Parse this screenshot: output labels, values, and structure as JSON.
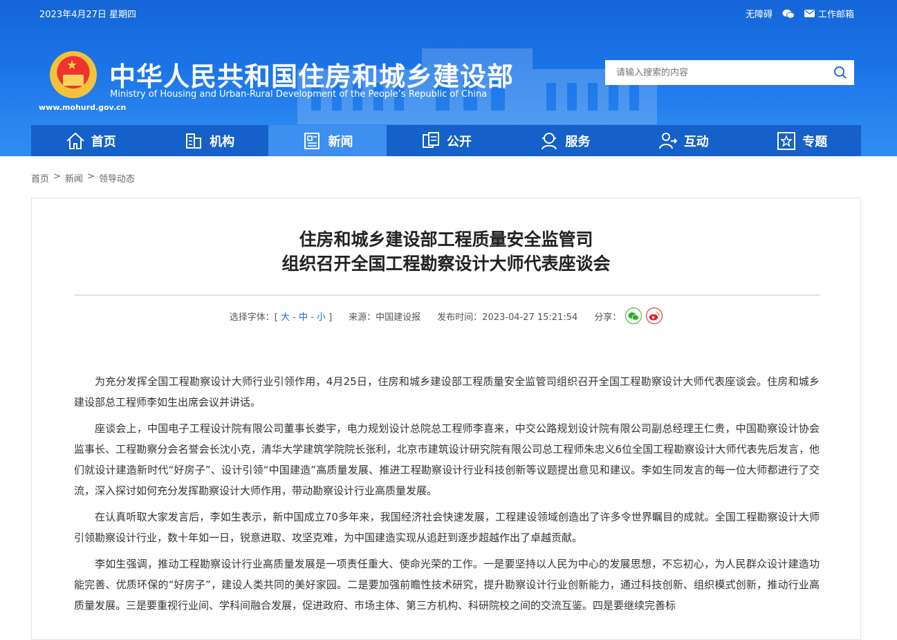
{
  "header": {
    "date": "2023年4月27日 星期四",
    "accessibility": "无障碍",
    "work_mail": "工作邮箱",
    "site_url": "www.mohurd.gov.cn",
    "cn_title": "中华人民共和国住房和城乡建设部",
    "en_title": "Ministry of Housing and Urban-Rural Development of the People’s Republic of China",
    "search_placeholder": "请输入搜索的内容"
  },
  "nav": [
    {
      "label": "首页",
      "icon": "home-icon"
    },
    {
      "label": "机构",
      "icon": "building-icon"
    },
    {
      "label": "新闻",
      "icon": "news-icon",
      "active": true
    },
    {
      "label": "公开",
      "icon": "document-icon"
    },
    {
      "label": "服务",
      "icon": "service-icon"
    },
    {
      "label": "互动",
      "icon": "interaction-icon"
    },
    {
      "label": "专题",
      "icon": "star-icon"
    }
  ],
  "breadcrumb": [
    "首页",
    "新闻",
    "领导动态"
  ],
  "article": {
    "title_line1": "住房和城乡建设部工程质量安全监管司",
    "title_line2": "组织召开全国工程勘察设计大师代表座谈会",
    "font_label": "选择字体：[",
    "font_large": "大",
    "font_medium": "中",
    "font_small": "小",
    "font_close": "]",
    "source": "来源：中国建设报",
    "publish_time": "发布时间：2023-04-27 15:21:54",
    "share_label": "分享：",
    "paragraphs": [
      "为充分发挥全国工程勘察设计大师行业引领作用，4月25日，住房和城乡建设部工程质量安全监管司组织召开全国工程勘察设计大师代表座谈会。住房和城乡建设部总工程师李如生出席会议并讲话。",
      "座谈会上，中国电子工程设计院有限公司董事长娄宇，电力规划设计总院总工程师李喜来，中交公路规划设计院有限公司副总经理王仁贵，中国勘察设计协会监事长、工程勘察分会名誉会长沈小克，清华大学建筑学院院长张利，北京市建筑设计研究院有限公司总工程师朱忠义6位全国工程勘察设计大师代表先后发言，他们就设计建造新时代“好房子”、设计引领“中国建造”高质量发展、推进工程勘察设计行业科技创新等议题提出意见和建议。李如生同发言的每一位大师都进行了交流，深入探讨如何充分发挥勘察设计大师作用，带动勘察设计行业高质量发展。",
      "在认真听取大家发言后，李如生表示，新中国成立70多年来，我国经济社会快速发展，工程建设领域创造出了许多令世界瞩目的成就。全国工程勘察设计大师引领勘察设计行业，数十年如一日，锐意进取、攻坚克难，为中国建造实现从追赶到逐步超越作出了卓越贡献。",
      "李如生强调，推动工程勘察设计行业高质量发展是一项责任重大、使命光荣的工作。一是要坚持以人民为中心的发展思想，不忘初心，为人民群众设计建造功能完善、优质环保的“好房子”，建设人类共同的美好家园。二是要加强前瞻性技术研究，提升勘察设计行业创新能力，通过科技创新、组织模式创新，推动行业高质量发展。三是要重视行业间、学科间融合发展，促进政府、市场主体、第三方机构、科研院校之间的交流互鉴。四是要继续完善标"
    ]
  },
  "colors": {
    "header_blue": "#1a73e6",
    "nav_blue": "#1560c9",
    "nav_active": "#3d8ff0",
    "link_blue": "#1a6ad6",
    "wechat_green": "#2aae2a",
    "weibo_red": "#e6162d"
  }
}
